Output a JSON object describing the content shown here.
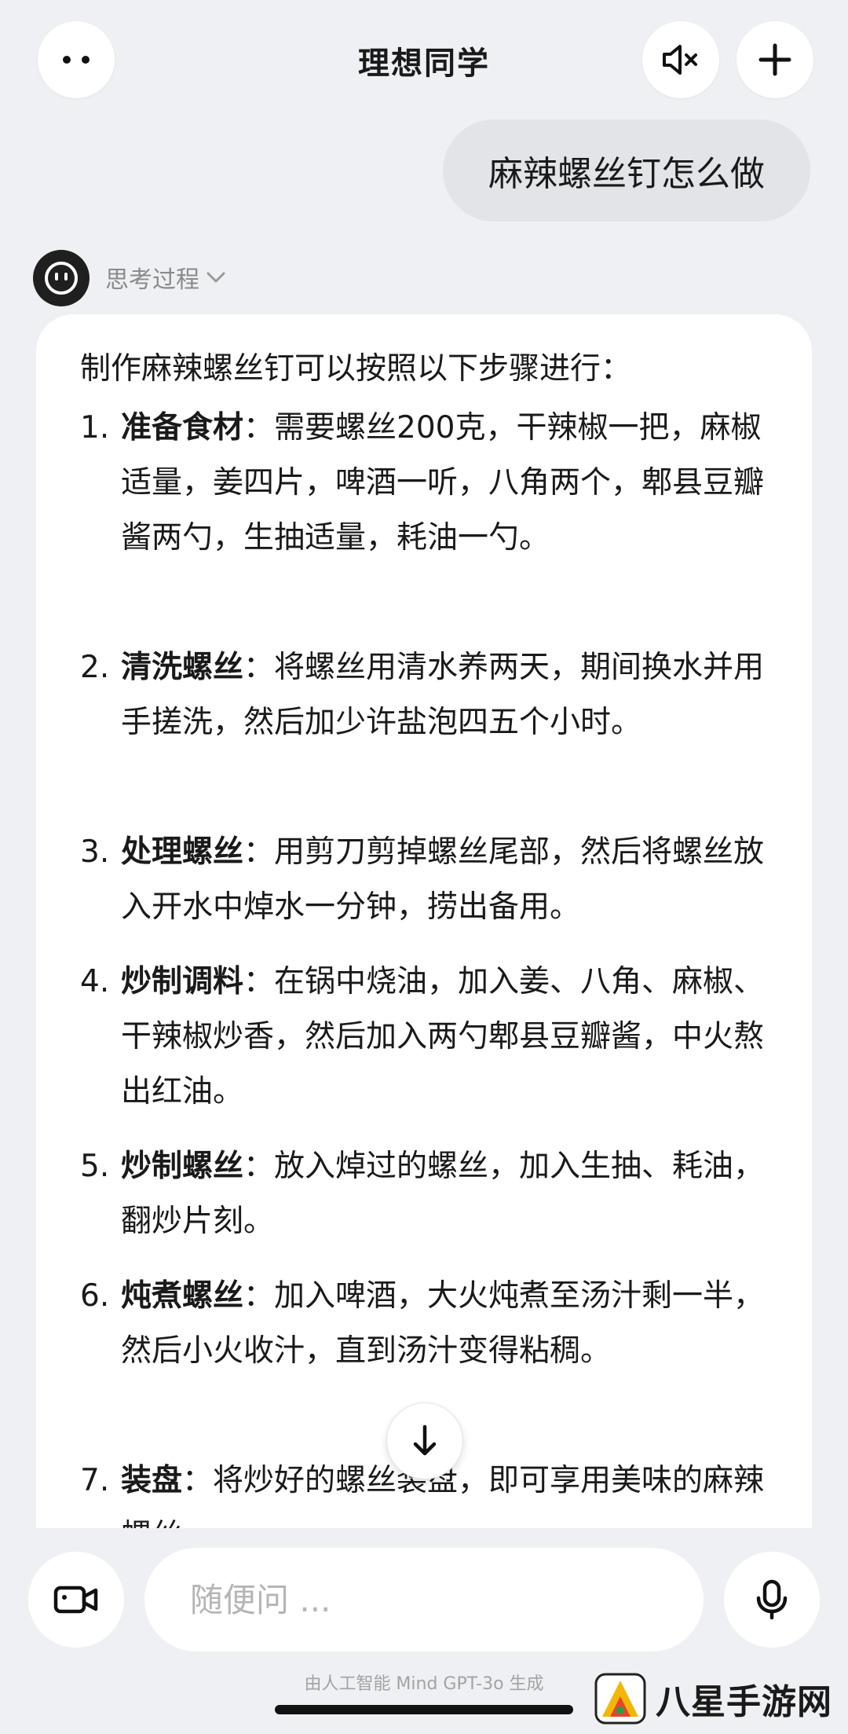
{
  "header": {
    "title": "理想同学"
  },
  "user_message": "麻辣螺丝钉怎么做",
  "assistant": {
    "thinking_label": "思考过程",
    "intro": "制作麻辣螺丝钉可以按照以下步骤进行：",
    "steps": [
      {
        "num": "1.",
        "title": "准备食材",
        "sep": "：",
        "text": "需要螺丝200克，干辣椒一把，麻椒适量，姜四片，啤酒一听，八角两个，郫县豆瓣酱两勺，生抽适量，耗油一勺。"
      },
      {
        "num": "2.",
        "title": "清洗螺丝",
        "sep": "：",
        "text": "将螺丝用清水养两天，期间换水并用手搓洗，然后加少许盐泡四五个小时。"
      },
      {
        "num": "3.",
        "title": "处理螺丝",
        "sep": "：",
        "text": "用剪刀剪掉螺丝尾部，然后将螺丝放入开水中焯水一分钟，捞出备用。"
      },
      {
        "num": "4.",
        "title": "炒制调料",
        "sep": "：",
        "text": "在锅中烧油，加入姜、八角、麻椒、干辣椒炒香，然后加入两勺郫县豆瓣酱，中火熬出红油。"
      },
      {
        "num": "5.",
        "title": "炒制螺丝",
        "sep": "：",
        "text": "放入焯过的螺丝，加入生抽、耗油，翻炒片刻。"
      },
      {
        "num": "6.",
        "title": "炖煮螺丝",
        "sep": "：",
        "text": "加入啤酒，大火炖煮至汤汁剩一半，然后小火收汁，直到汤汁变得粘稠。"
      },
      {
        "num": "7.",
        "title": "装盘",
        "sep": "：",
        "text": "将炒好的螺丝装盘，即可享用美味的麻辣螺丝"
      }
    ]
  },
  "input": {
    "placeholder": "随便问 ..."
  },
  "footer": {
    "disclaimer": "由人工智能 Mind GPT-3o 生成",
    "watermark": "八星手游网"
  },
  "icons": {
    "menu": "dots-icon",
    "mute": "speaker-muted-icon",
    "new": "plus-icon",
    "avatar": "robot-face-icon",
    "scroll": "arrow-down-icon",
    "video": "video-camera-icon",
    "mic": "microphone-icon"
  },
  "colors": {
    "background": "#eef0f3",
    "card": "#ffffff",
    "user_bubble": "#e2e4e8",
    "muted_text": "#8a8a8a"
  }
}
